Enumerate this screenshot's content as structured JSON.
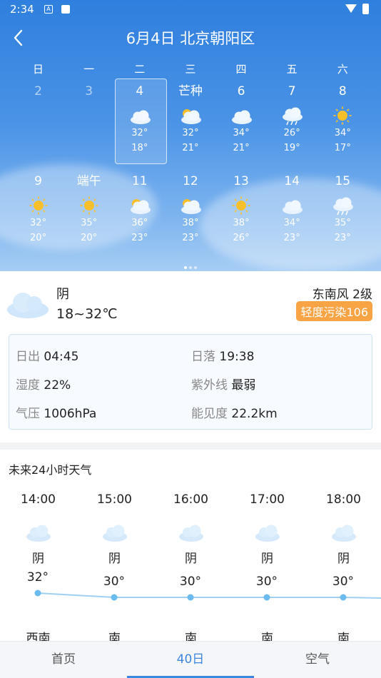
{
  "status": {
    "time": "2:34"
  },
  "header": {
    "title": "6月4日 北京朝阳区"
  },
  "weekdays": [
    "日",
    "一",
    "二",
    "三",
    "四",
    "五",
    "六"
  ],
  "week1": [
    {
      "day": "2",
      "icon": "",
      "high": "",
      "low": "",
      "past": true
    },
    {
      "day": "3",
      "icon": "",
      "high": "",
      "low": "",
      "past": true
    },
    {
      "day": "4",
      "icon": "cloud-icon",
      "high": "32°",
      "low": "18°",
      "selected": true
    },
    {
      "day": "芒种",
      "icon": "partly-cloudy-icon",
      "high": "32°",
      "low": "21°"
    },
    {
      "day": "6",
      "icon": "cloud-icon",
      "high": "34°",
      "low": "21°"
    },
    {
      "day": "7",
      "icon": "rain-icon",
      "high": "26°",
      "low": "19°"
    },
    {
      "day": "8",
      "icon": "sun-icon",
      "high": "34°",
      "low": "17°"
    }
  ],
  "week2": [
    {
      "day": "9",
      "icon": "sun-icon",
      "high": "32°",
      "low": "20°"
    },
    {
      "day": "端午",
      "icon": "sun-icon",
      "high": "35°",
      "low": "20°"
    },
    {
      "day": "11",
      "icon": "partly-cloudy-icon",
      "high": "36°",
      "low": "23°"
    },
    {
      "day": "12",
      "icon": "partly-cloudy-icon",
      "high": "38°",
      "low": "23°"
    },
    {
      "day": "13",
      "icon": "sun-icon",
      "high": "38°",
      "low": "26°"
    },
    {
      "day": "14",
      "icon": "cloud-icon",
      "high": "34°",
      "low": "23°"
    },
    {
      "day": "15",
      "icon": "rain-icon",
      "high": "35°",
      "low": "23°"
    }
  ],
  "today": {
    "condition": "阴",
    "range": "18~32℃",
    "wind": "东南风 2级",
    "aqi": "轻度污染106",
    "aqi_color": "#f8a344"
  },
  "details": {
    "sunrise_label": "日出",
    "sunrise": "04:45",
    "sunset_label": "日落",
    "sunset": "19:38",
    "humidity_label": "湿度",
    "humidity": "22%",
    "uv_label": "紫外线",
    "uv": "最弱",
    "pressure_label": "气压",
    "pressure": "1006hPa",
    "visibility_label": "能见度",
    "visibility": "22.2km"
  },
  "hourly": {
    "title": "未来24小时天气",
    "items": [
      {
        "time": "14:00",
        "cond": "阴",
        "temp": "32°",
        "wind": "西南"
      },
      {
        "time": "15:00",
        "cond": "阴",
        "temp": "30°",
        "wind": "南"
      },
      {
        "time": "16:00",
        "cond": "阴",
        "temp": "30°",
        "wind": "南"
      },
      {
        "time": "17:00",
        "cond": "阴",
        "temp": "30°",
        "wind": "南"
      },
      {
        "time": "18:00",
        "cond": "阴",
        "temp": "30°",
        "wind": "南"
      }
    ]
  },
  "nav": {
    "home": "首页",
    "forty": "40日",
    "air": "空气"
  },
  "colors": {
    "accent": "#3d86e0",
    "sky_top": "#2f7fde"
  }
}
